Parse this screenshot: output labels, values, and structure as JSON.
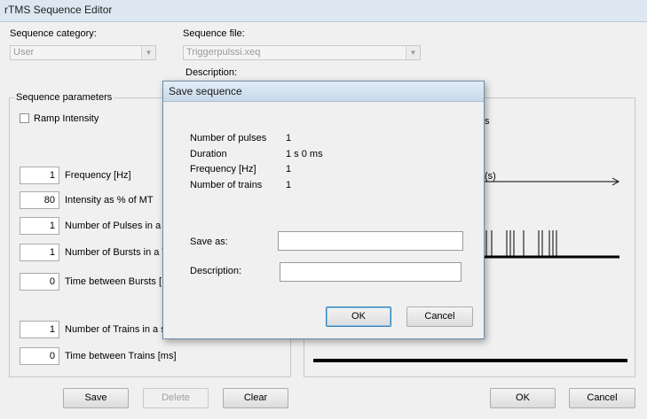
{
  "window": {
    "title": "rTMS Sequence Editor"
  },
  "header": {
    "category_label": "Sequence category:",
    "category_value": "User",
    "file_label": "Sequence file:",
    "file_value": "Triggerpulssi.xeq",
    "description_label": "Description:"
  },
  "params": {
    "group_title": "Sequence parameters",
    "ramp_label": "Ramp Intensity",
    "fields": [
      {
        "value": "1",
        "label": "Frequency [Hz]"
      },
      {
        "value": "80",
        "label": "Intensity as % of MT"
      },
      {
        "value": "1",
        "label": "Number of Pulses in a b"
      },
      {
        "value": "1",
        "label": "Number of Bursts in a T"
      },
      {
        "value": "0",
        "label": "Time between Bursts ["
      },
      {
        "value": "1",
        "label": "Number of Trains in a s"
      },
      {
        "value": "0",
        "label": "Time between Trains [ms]"
      }
    ]
  },
  "preview": {
    "frag_s": "s",
    "frag_axis": "(s)"
  },
  "buttons": {
    "save": "Save",
    "delete": "Delete",
    "clear": "Clear",
    "ok": "OK",
    "cancel": "Cancel"
  },
  "dialog": {
    "title": "Save sequence",
    "info": [
      {
        "label": "Number of pulses",
        "value": "1"
      },
      {
        "label": "Duration",
        "value": "1 s 0 ms"
      },
      {
        "label": "Frequency [Hz]",
        "value": "1"
      },
      {
        "label": "Number of trains",
        "value": "1"
      }
    ],
    "save_as_label": "Save as:",
    "save_as_value": "",
    "description_label": "Description:",
    "description_value": "",
    "ok": "OK",
    "cancel": "Cancel"
  },
  "colors": {
    "title_bg": "#dce7f2",
    "dialog_border": "#6e8caa",
    "ok_focus": "#3c7fb1"
  }
}
